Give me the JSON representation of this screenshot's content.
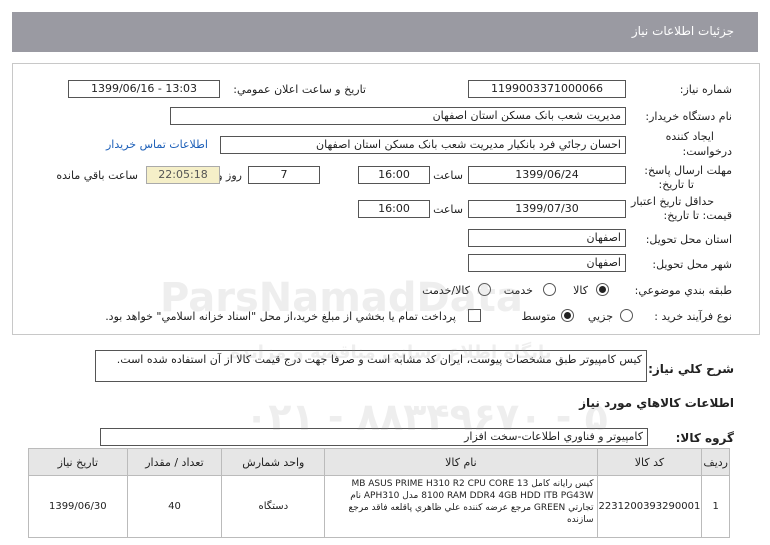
{
  "page_title": "جزئيات اطلاعات نياز",
  "fields": {
    "need_number_label": "شماره نياز:",
    "need_number": "1199003371000066",
    "announce_label": "تاريخ و ساعت اعلان عمومي:",
    "announce_value": "1399/06/16 - 13:03",
    "buyer_label": "نام دستگاه خريدار:",
    "buyer_value": "مديريت شعب بانک مسکن استان اصفهان",
    "creator_label": "ايجاد کننده",
    "creator_label2": "درخواست:",
    "creator_value": "احسان  رجائي فرد  بانکيار  مديريت شعب بانک مسکن استان اصفهان",
    "contact_link": "اطلاعات تماس خريدار",
    "deadline_label": "مهلت ارسال پاسخ:",
    "deadline_label2": "تا تاريخ:",
    "deadline_date": "1399/06/24",
    "time_label": "ساعت",
    "deadline_time": "16:00",
    "days_value": "7",
    "days_label": "روز و",
    "remaining_time": "22:05:18",
    "remaining_label": "ساعت باقي مانده",
    "validity_label": "حداقل تاريخ اعتبار",
    "validity_label2": "قيمت: تا تاريخ:",
    "validity_date": "1399/07/30",
    "validity_time": "16:00",
    "province_label": "استان محل تحويل:",
    "province_value": "اصفهان",
    "city_label": "شهر محل تحويل:",
    "city_value": "اصفهان",
    "category_label": "طبقه بندي موضوعي:",
    "category_options": [
      "کالا",
      "خدمت",
      "کالا/خدمت"
    ],
    "process_label": "نوع فرآيند خريد :",
    "process_options": [
      "جزيي",
      "متوسط"
    ],
    "payment_note": "پرداخت تمام يا بخشي از مبلغ خريد،از محل \"اسناد خزانه اسلامي\" خواهد بود."
  },
  "description": {
    "label": "شرح کلي نياز:",
    "text": "کيس کامپيوتر طبق مشخصات پيوست، ايران کد مشابه است و صرفا جهت درج قيمت کالا از آن استفاده شده است."
  },
  "goods": {
    "section_title": "اطلاعات کالاهاي مورد نياز",
    "group_label": "گروه کالا:",
    "group_value": "کامپيوتر و فناوري اطلاعات-سخت افزار",
    "columns": [
      "رديف",
      "کد کالا",
      "نام کالا",
      "واحد شمارش",
      "تعداد / مقدار",
      "تاريخ نياز"
    ],
    "rows": [
      {
        "index": "1",
        "code": "2231200393290001",
        "name": "کيس رايانه کامل MB ASUS PRIME H310 R2 CPU CORE 13 8100 RAM DDR4 4GB HDD ITB PG43W مدل APH310 نام تجارتي GREEN مرجع عرضه کننده علي ظاهري پاقلعه فاقد مرجع سازنده",
        "unit": "دستگاه",
        "qty": "40",
        "date": "1399/06/30"
      }
    ]
  },
  "watermark": {
    "line1": "ParsNamadData",
    "line2": "پايگاه اطلاع رساني مناقصه و مزايده",
    "line3": "۰۲۱ - ۸۸۳۴۹۶۷۰ - ۵"
  }
}
